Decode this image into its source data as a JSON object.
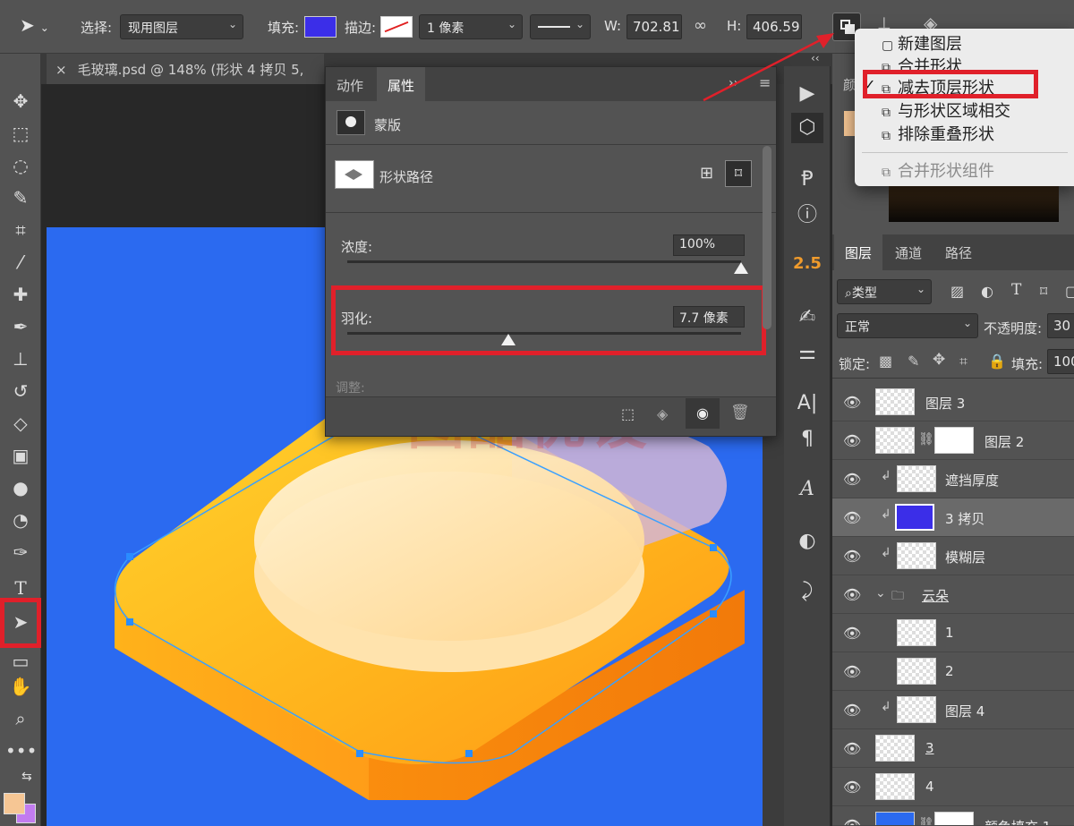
{
  "options_bar": {
    "select_label": "选择:",
    "select_value": "现用图层",
    "fill_label": "填充:",
    "fill_color": "#3b2ee8",
    "stroke_label": "描边:",
    "stroke_width": "1 像素",
    "w_label": "W:",
    "w_value": "702.81",
    "h_label": "H:",
    "h_value": "406.59"
  },
  "doc_tab": {
    "title": "毛玻璃.psd @ 148% (形状 4 拷贝 5,"
  },
  "properties_panel": {
    "tabs": [
      "动作",
      "属性"
    ],
    "active_tab": "属性",
    "mask_label": "蒙版",
    "shape_path_label": "形状路径",
    "density_label": "浓度:",
    "density_value": "100%",
    "density_level": 1.0,
    "feather_label": "羽化:",
    "feather_value": "7.7 像素",
    "feather_level": 0.41,
    "adjust_label": "调整:"
  },
  "path_ops_menu": {
    "items": [
      {
        "label": "新建图层",
        "checked": false,
        "enabled": true
      },
      {
        "label": "合并形状",
        "checked": false,
        "enabled": true
      },
      {
        "label": "减去顶层形状",
        "checked": true,
        "enabled": true
      },
      {
        "label": "与形状区域相交",
        "checked": false,
        "enabled": true
      },
      {
        "label": "排除重叠形状",
        "checked": false,
        "enabled": true
      },
      {
        "label": "合并形状组件",
        "checked": false,
        "enabled": false
      }
    ]
  },
  "icon_strip": {
    "badge": "2.5"
  },
  "right_panel": {
    "color_tab_partial": "颜",
    "tabs": [
      "图层",
      "通道",
      "路径"
    ],
    "active_tab": "图层",
    "filter_value": "类型",
    "blend_mode": "正常",
    "opacity_label": "不透明度:",
    "opacity_value": "30",
    "lock_label": "锁定:",
    "fill_label": "填充:",
    "fill_value": "100",
    "layers": [
      {
        "name": "图层 3"
      },
      {
        "name": "图层 2"
      },
      {
        "name": "遮挡厚度"
      },
      {
        "name": "3 拷贝"
      },
      {
        "name": "模糊层"
      },
      {
        "name": "云朵"
      },
      {
        "name": "1"
      },
      {
        "name": "2"
      },
      {
        "name": "图层 4"
      },
      {
        "name": "3"
      },
      {
        "name": "4"
      },
      {
        "name": "颜色填充 1"
      }
    ]
  },
  "colors": {
    "highlight_red": "#e0202a",
    "canvas_blue": "#2b6af0",
    "foreground_swatch": "#f6c694",
    "background_swatch": "#c27cf0"
  },
  "watermark": "图酷优设"
}
